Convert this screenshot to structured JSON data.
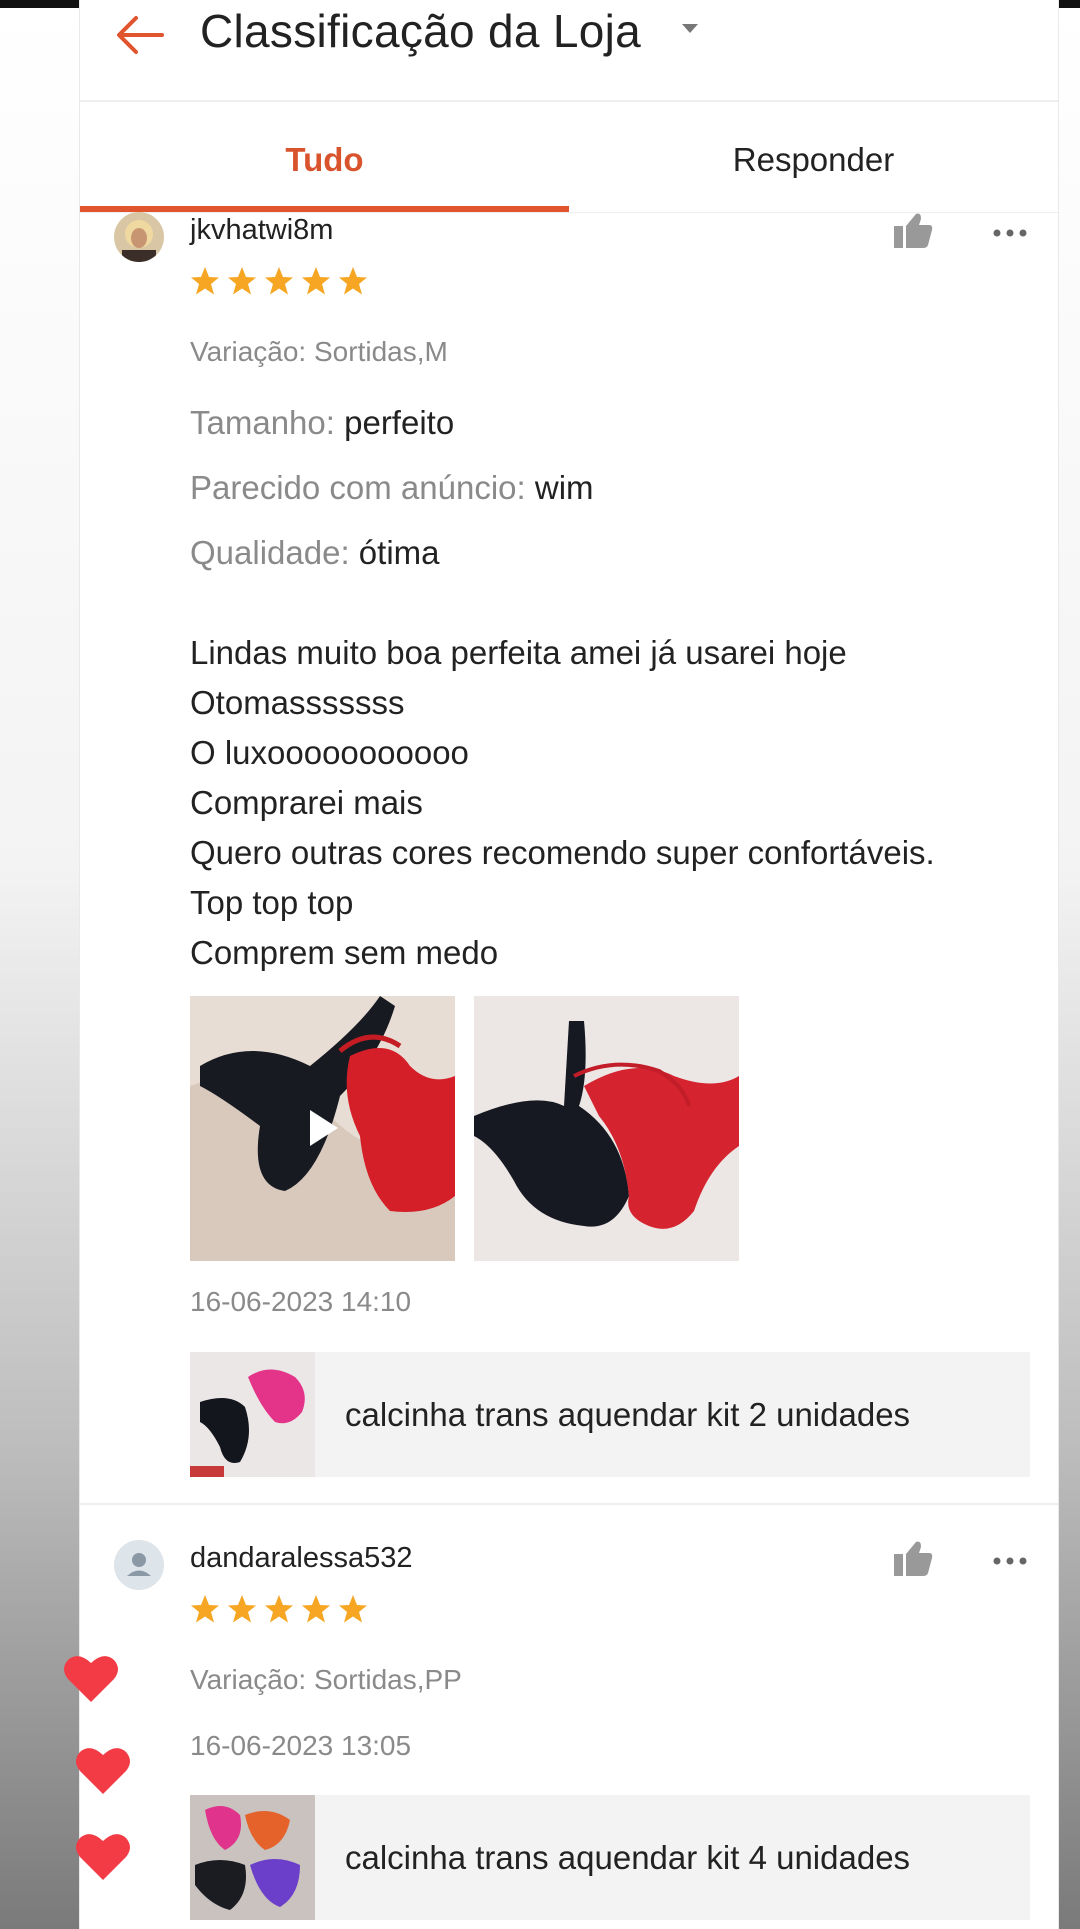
{
  "header": {
    "title": "Classificação da Loja",
    "back_icon": "arrow-left-icon",
    "dropdown_icon": "caret-down-icon"
  },
  "tabs": [
    {
      "label": "Tudo",
      "active": true
    },
    {
      "label": "Responder",
      "active": false
    }
  ],
  "colors": {
    "accent": "#e0542e",
    "star": "#f6a623",
    "heart": "#f23b45"
  },
  "reviews": [
    {
      "username": "jkvhatwi8m",
      "rating": 5,
      "variation": "Variação: Sortidas,M",
      "attributes": [
        {
          "label": "Tamanho:",
          "value": "perfeito"
        },
        {
          "label": "Parecido com anúncio:",
          "value": "wim"
        },
        {
          "label": "Qualidade:",
          "value": "ótima"
        }
      ],
      "text_lines": [
        "Lindas muito boa perfeita amei já usarei hoje",
        "Otomasssssss",
        "O luxooooooooooo",
        "Comprarei mais",
        "Quero outras cores recomendo super confortáveis.",
        "Top top top",
        "Comprem sem medo"
      ],
      "media": [
        {
          "kind": "video",
          "icon": "play-icon"
        },
        {
          "kind": "photo"
        }
      ],
      "date": "16-06-2023 14:10",
      "product": "calcinha trans aquendar kit 2 unidades"
    },
    {
      "username": "dandaralessa532",
      "rating": 5,
      "variation": "Variação: Sortidas,PP",
      "date": "16-06-2023 13:05",
      "product": "calcinha trans aquendar kit 4 unidades"
    }
  ],
  "overlay": {
    "hearts": 3,
    "icon": "heart-icon"
  }
}
